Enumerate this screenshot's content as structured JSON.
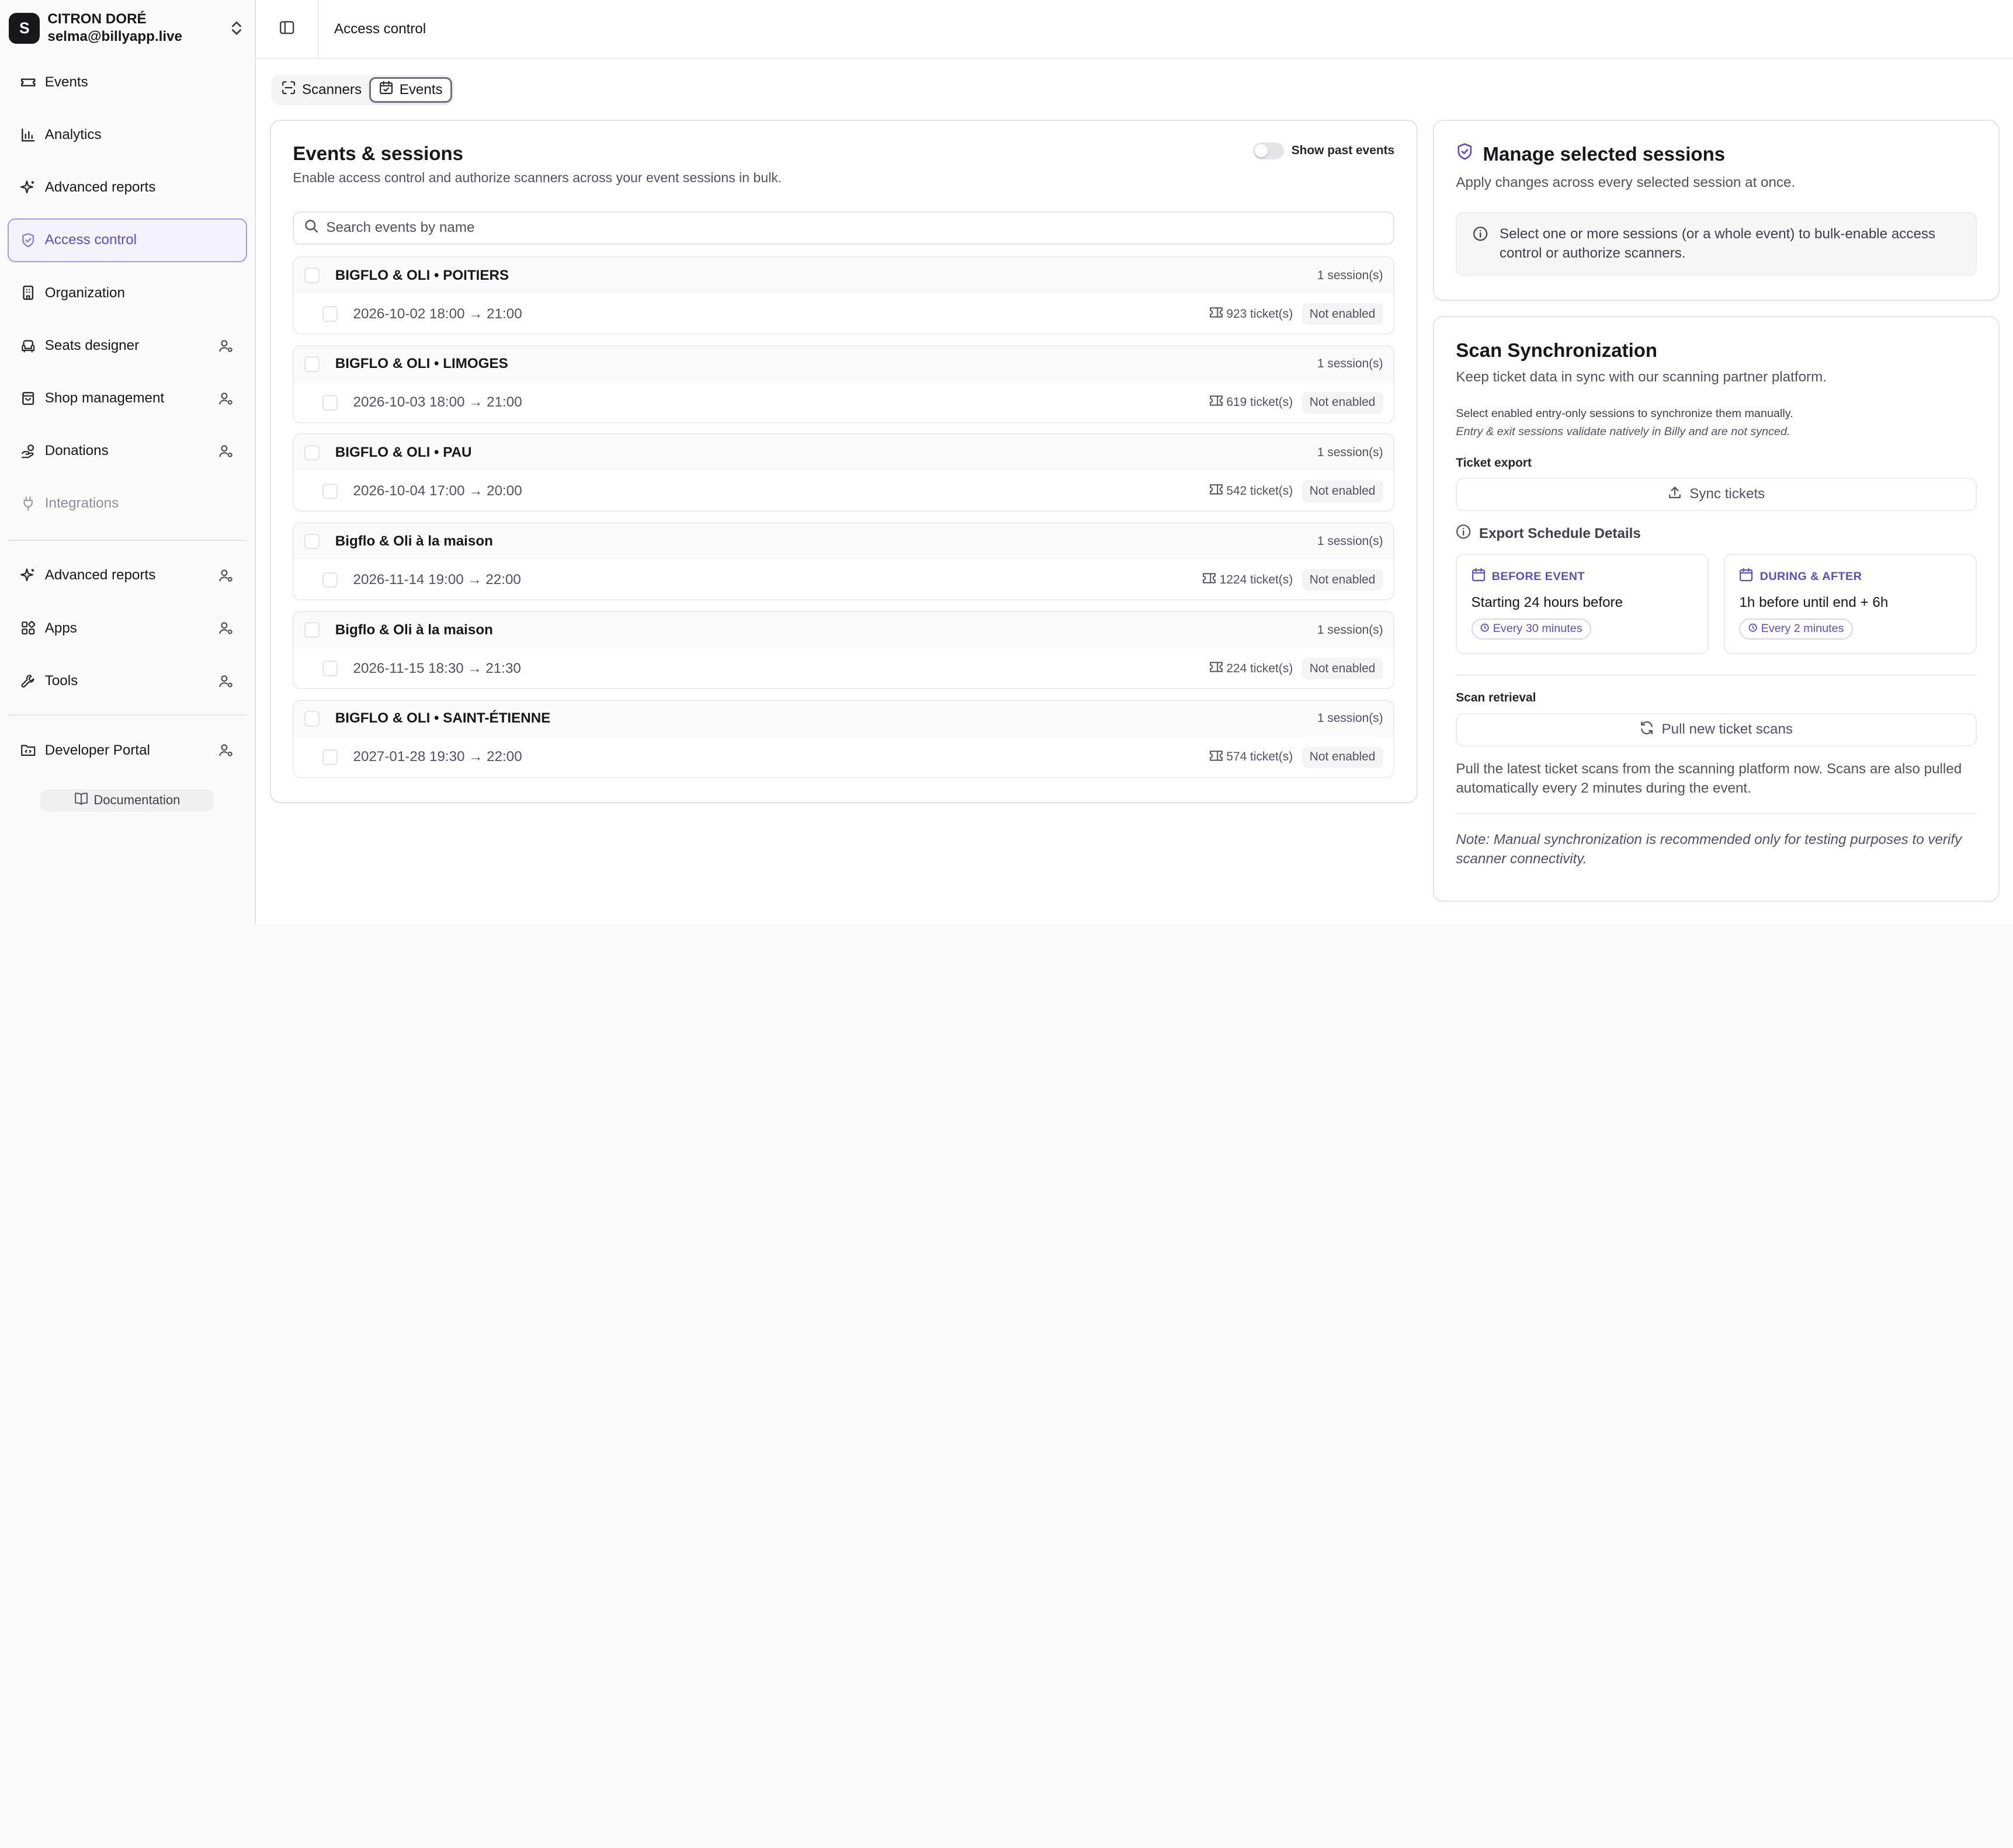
{
  "org": {
    "initial": "S",
    "name": "CITRON DORÉ",
    "email": "selma@billyapp.live"
  },
  "sidebar": {
    "items": [
      {
        "label": "Events",
        "icon": "ticket-icon"
      },
      {
        "label": "Analytics",
        "icon": "bar-chart-icon"
      },
      {
        "label": "Advanced reports",
        "icon": "sparkles-icon"
      },
      {
        "label": "Access control",
        "icon": "shield-check-icon",
        "active": true
      },
      {
        "label": "Organization",
        "icon": "building-icon"
      },
      {
        "label": "Seats designer",
        "icon": "armchair-icon",
        "admin": true
      },
      {
        "label": "Shop management",
        "icon": "shopping-bag-icon",
        "admin": true
      },
      {
        "label": "Donations",
        "icon": "hand-coins-icon",
        "admin": true
      },
      {
        "label": "Integrations",
        "icon": "plug-icon",
        "muted": true
      }
    ],
    "secondary": [
      {
        "label": "Advanced reports",
        "icon": "sparkles-icon"
      },
      {
        "label": "Apps",
        "icon": "grid-icon"
      },
      {
        "label": "Tools",
        "icon": "wrench-icon"
      }
    ],
    "developer": "Developer Portal",
    "documentation": "Documentation"
  },
  "header": {
    "breadcrumb": "Access control"
  },
  "tabs": [
    {
      "label": "Scanners"
    },
    {
      "label": "Events",
      "active": true
    }
  ],
  "events_card": {
    "title": "Events & sessions",
    "subtitle": "Enable access control and authorize scanners across your event sessions in bulk.",
    "show_past_label": "Show past events",
    "search_placeholder": "Search events by name",
    "events": [
      {
        "name": "BIGFLO & OLI • POITIERS",
        "count": "1 session(s)",
        "date": "2026-10-02 18:00 → 21:00",
        "tickets": "923 ticket(s)",
        "status": "Not enabled"
      },
      {
        "name": "BIGFLO & OLI • LIMOGES",
        "count": "1 session(s)",
        "date": "2026-10-03 18:00 → 21:00",
        "tickets": "619 ticket(s)",
        "status": "Not enabled"
      },
      {
        "name": "BIGFLO & OLI • PAU",
        "count": "1 session(s)",
        "date": "2026-10-04 17:00 → 20:00",
        "tickets": "542 ticket(s)",
        "status": "Not enabled"
      },
      {
        "name": "Bigflo & Oli à la maison",
        "count": "1 session(s)",
        "date": "2026-11-14 19:00 → 22:00",
        "tickets": "1224 ticket(s)",
        "status": "Not enabled"
      },
      {
        "name": "Bigflo & Oli à la maison",
        "count": "1 session(s)",
        "date": "2026-11-15 18:30 → 21:30",
        "tickets": "224 ticket(s)",
        "status": "Not enabled"
      },
      {
        "name": "BIGFLO & OLI • SAINT-ÉTIENNE",
        "count": "1 session(s)",
        "date": "2027-01-28 19:30 → 22:00",
        "tickets": "574 ticket(s)",
        "status": "Not enabled"
      }
    ]
  },
  "manage_card": {
    "title": "Manage selected sessions",
    "subtitle": "Apply changes across every selected session at once.",
    "info": "Select one or more sessions (or a whole event) to bulk-enable access control or authorize scanners."
  },
  "sync_card": {
    "title": "Scan Synchronization",
    "subtitle": "Keep ticket data in sync with our scanning partner platform.",
    "note_line1": "Select enabled entry-only sessions to synchronize them manually.",
    "note_line2": "Entry & exit sessions validate natively in Billy and are not synced.",
    "ticket_export_label": "Ticket export",
    "sync_button": "Sync tickets",
    "schedule_title": "Export Schedule Details",
    "before": {
      "label": "BEFORE EVENT",
      "desc": "Starting 24 hours before",
      "chip": "Every 30 minutes"
    },
    "during": {
      "label": "DURING & AFTER",
      "desc": "1h before until end + 6h",
      "chip": "Every 2 minutes"
    },
    "scan_retrieval_label": "Scan retrieval",
    "pull_button": "Pull new ticket scans",
    "pull_desc": "Pull the latest ticket scans from the scanning platform now. Scans are also pulled automatically every 2 minutes during the event.",
    "manual_note": "Note: Manual synchronization is recommended only for testing purposes to verify scanner connectivity."
  },
  "colors": {
    "accent": "#5b4bd1",
    "accent_border": "#a59ae4",
    "active_bg": "#f4f2fc"
  }
}
